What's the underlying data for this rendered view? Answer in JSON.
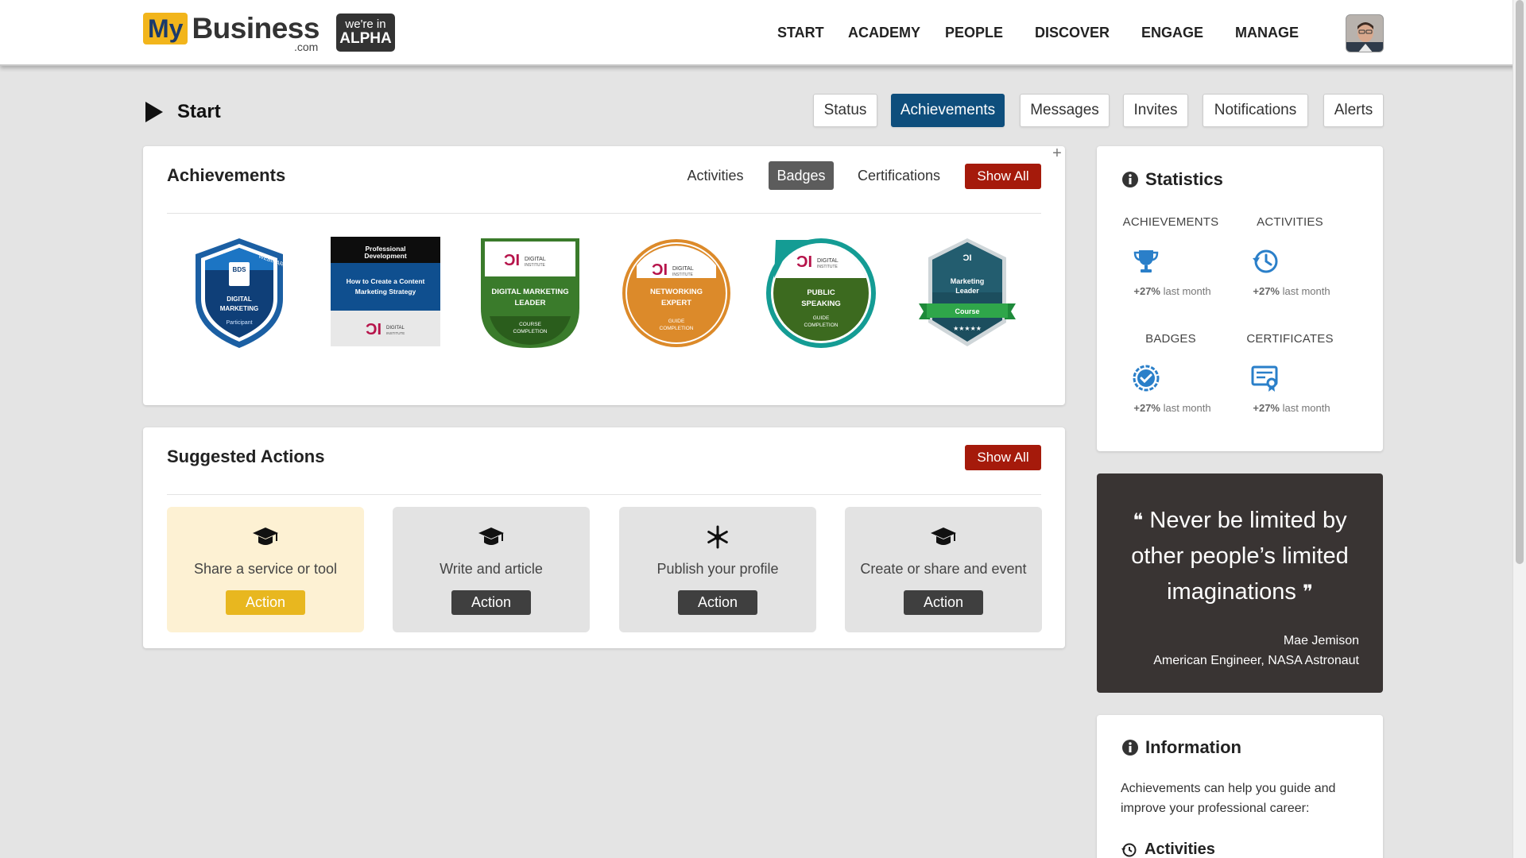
{
  "header": {
    "logo_my": "My",
    "logo_business": "Business",
    "logo_com": ".com",
    "alpha_line1": "we're in",
    "alpha_line2": "ALPHA",
    "nav": [
      "START",
      "ACADEMY",
      "PEOPLE",
      "DISCOVER",
      "ENGAGE",
      "MANAGE"
    ]
  },
  "page": {
    "title": "Start",
    "tabs": [
      "Status",
      "Achievements",
      "Messages",
      "Invites",
      "Notifications",
      "Alerts"
    ],
    "active_tab": "Achievements"
  },
  "achievements": {
    "title": "Achievements",
    "filters": [
      "Activities",
      "Badges",
      "Certifications"
    ],
    "active_filter": "Badges",
    "show_all": "Show All",
    "badges": [
      {
        "name": "webinar-digital-marketing-badge",
        "top_text": "WEBINAR",
        "logo": "BDS",
        "line1": "DIGITAL",
        "line2": "MARKETING",
        "foot": "Participant",
        "color": "#0f4f8f"
      },
      {
        "name": "content-marketing-badge",
        "top_text": "Professional",
        "top_text2": "Development",
        "line1": "How to Create a Content",
        "line2": "Marketing Strategy",
        "logo_text": "DIGITAL",
        "logo_sub": "INSTITUTE",
        "color": "#0f4f8f"
      },
      {
        "name": "digital-marketing-leader-badge",
        "logo_text": "DIGITAL",
        "logo_sub": "INSTITUTE",
        "line1": "DIGITAL MARKETING",
        "line2": "LEADER",
        "foot1": "COURSE",
        "foot2": "COMPLETION",
        "color": "#3b7a2a"
      },
      {
        "name": "networking-expert-badge",
        "logo_text": "DIGITAL",
        "logo_sub": "INSTITUTE",
        "line1": "NETWORKING",
        "line2": "EXPERT",
        "foot1": "GUIDE",
        "foot2": "COMPLETION",
        "color": "#dc8a2a"
      },
      {
        "name": "public-speaking-badge",
        "logo_text": "DIGITAL",
        "logo_sub": "INSTITUTE",
        "line1": "PUBLIC",
        "line2": "SPEAKING",
        "foot1": "GUIDE",
        "foot2": "COMPLETION",
        "color": "#3e6b1f"
      },
      {
        "name": "marketing-leader-course-badge",
        "line1": "Marketing",
        "line2": "Leader",
        "ribbon": "Course",
        "color": "#1c4e5e"
      }
    ]
  },
  "suggested": {
    "title": "Suggested Actions",
    "show_all": "Show All",
    "cards": [
      {
        "label": "Share a service or tool",
        "button": "Action",
        "icon": "graduation-cap-icon"
      },
      {
        "label": "Write and article",
        "button": "Action",
        "icon": "graduation-cap-icon"
      },
      {
        "label": "Publish your profile",
        "button": "Action",
        "icon": "asterisk-icon"
      },
      {
        "label": "Create or share and event",
        "button": "Action",
        "icon": "graduation-cap-icon"
      }
    ]
  },
  "statistics": {
    "title": "Statistics",
    "items": [
      {
        "label": "ACHIEVEMENTS",
        "pct": "+27%",
        "period": "last month",
        "icon": "trophy-icon"
      },
      {
        "label": "ACTIVITIES",
        "pct": "+27%",
        "period": "last month",
        "icon": "history-icon"
      },
      {
        "label": "BADGES",
        "pct": "+27%",
        "period": "last month",
        "icon": "badge-check-icon"
      },
      {
        "label": "CERTIFICATES",
        "pct": "+27%",
        "period": "last month",
        "icon": "certificate-icon"
      }
    ]
  },
  "quote": {
    "text": "Never be limited by other people’s limited imaginations",
    "author": "Mae Jemison",
    "role": "American Engineer, NASA Astronaut"
  },
  "information": {
    "title": "Information",
    "text": "Achievements can help you guide and improve your professional career:",
    "sub_heading": "Activities"
  },
  "colors": {
    "brand_blue": "#0e4e7c",
    "red": "#a51a0b",
    "yellow": "#e8b71f",
    "stat_blue": "#2a7fc9"
  }
}
